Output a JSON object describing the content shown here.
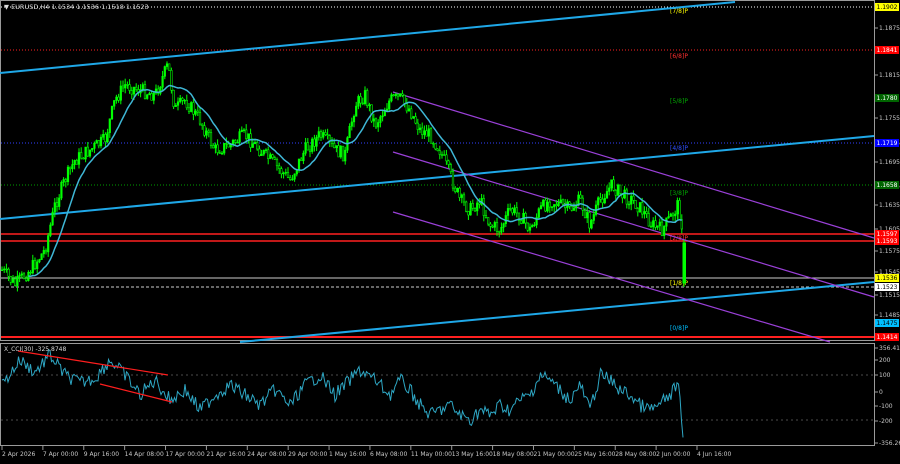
{
  "chart_header": "▼ EURUSD,H4  1.1534 1.1536 1.1518 1.1523",
  "indicator_header": "X_CCI(30) -325.8748",
  "price_axis": {
    "ticks": [
      "1.1875",
      "1.1815",
      "1.1755",
      "1.1725",
      "1.1695",
      "1.1665",
      "1.1635",
      "1.1605",
      "1.1575",
      "1.1545",
      "1.1515",
      "1.1485"
    ],
    "tags": [
      {
        "label": "1.1902",
        "bg": "#ffff00",
        "fg": "#000000"
      },
      {
        "label": "1.1841",
        "bg": "#ff0000",
        "fg": "#ffffff"
      },
      {
        "label": "1.1780",
        "bg": "#006400",
        "fg": "#ffffff"
      },
      {
        "label": "1.1719",
        "bg": "#0000ff",
        "fg": "#ffffff"
      },
      {
        "label": "1.1658",
        "bg": "#006400",
        "fg": "#ffffff"
      },
      {
        "label": "1.1597",
        "bg": "#ff0000",
        "fg": "#ffffff"
      },
      {
        "label": "1.1593",
        "bg": "#ff0000",
        "fg": "#ffffff"
      },
      {
        "label": "1.1536",
        "bg": "#ffff00",
        "fg": "#000000"
      },
      {
        "label": "1.1523",
        "bg": "#ffffff",
        "fg": "#000000"
      },
      {
        "label": "1.1475",
        "bg": "#00bfff",
        "fg": "#000000"
      },
      {
        "label": "1.1414",
        "bg": "#ff0000",
        "fg": "#ffffff"
      }
    ]
  },
  "murrey_labels": [
    {
      "text": "[7/8]P",
      "color": "#ffff00"
    },
    {
      "text": "[6/8]P",
      "color": "#ff3030"
    },
    {
      "text": "[5/8]P",
      "color": "#00aa00"
    },
    {
      "text": "[4/8]P",
      "color": "#3050ff"
    },
    {
      "text": "[3/8]P",
      "color": "#00aa00"
    },
    {
      "text": "[2/8]P",
      "color": "#ff3030"
    },
    {
      "text": "[1/8]P",
      "color": "#ffff00"
    },
    {
      "text": "[0/8]P",
      "color": "#00bfff"
    }
  ],
  "cci_axis": {
    "ticks": [
      "356.4179",
      "200",
      "100",
      "0",
      "-100",
      "-200",
      "-356.2697"
    ]
  },
  "time_axis": {
    "labels": [
      "2 Apr 2026",
      "7 Apr 00:00",
      "9 Apr 16:00",
      "14 Apr 08:00",
      "17 Apr 00:00",
      "21 Apr 16:00",
      "24 Apr 08:00",
      "29 Apr 00:00",
      "1 May 16:00",
      "6 May 08:00",
      "11 May 00:00",
      "13 May 16:00",
      "18 May 08:00",
      "21 May 00:00",
      "25 May 16:00",
      "28 May 08:00",
      "2 Jun 00:00",
      "4 Jun 16:00"
    ]
  },
  "colors": {
    "background": "#000000",
    "candles": "#00ff00",
    "moving_average": "#3fb7d6",
    "trend_lines": "#1fa8e8",
    "channel_lines": "#9a40d8",
    "cci_line": "#2ea7c4",
    "divergence_lines": "#ff1e1e",
    "axis_text": "#c8c8c8"
  }
}
